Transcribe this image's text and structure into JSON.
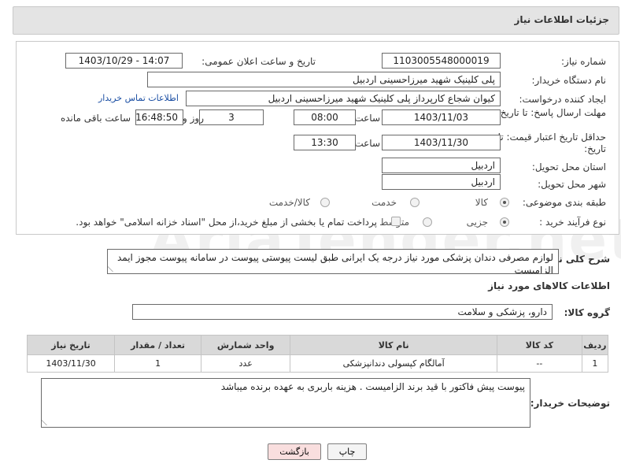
{
  "header": {
    "title": "جزئیات اطلاعات نیاز"
  },
  "form": {
    "need_number_label": "شماره نیاز:",
    "need_number": "1103005548000019",
    "announce_label": "تاریخ و ساعت اعلان عمومی:",
    "announce_value": "1403/10/29 - 14:07",
    "buyer_org_label": "نام دستگاه خریدار:",
    "buyer_org": "پلی کلینیک شهید میرزاحسینی اردبیل",
    "creator_label": "ایجاد کننده درخواست:",
    "creator": "کیوان شجاع کارپرداز پلی کلینیک شهید میرزاحسینی اردبیل",
    "contact_link": "اطلاعات تماس خریدار",
    "reply_deadline_label": "مهلت ارسال پاسخ: تا تاریخ:",
    "reply_date": "1403/11/03",
    "time_label": "ساعت",
    "reply_time": "08:00",
    "days": "3",
    "days_and": "روز و",
    "remaining_time": "16:48:50",
    "remaining_label": "ساعت باقی مانده",
    "validity_label": "حداقل تاریخ اعتبار قیمت: تا تاریخ:",
    "validity_date": "1403/11/30",
    "validity_time": "13:30",
    "province_label": "استان محل تحویل:",
    "province": "اردبیل",
    "city_label": "شهر محل تحویل:",
    "city": "اردبیل",
    "category_label": "طبقه بندی موضوعی:",
    "category_options": [
      "کالا",
      "خدمت",
      "کالا/خدمت"
    ],
    "process_label": "نوع فرآیند خرید :",
    "process_options": [
      "جزیی",
      "متوسط"
    ],
    "payment_note": "پرداخت تمام یا بخشی از مبلغ خرید،از محل \"اسناد خزانه اسلامی\" خواهد بود."
  },
  "description": {
    "label": "شرح کلی نیاز:",
    "text": "لوازم مصرفی دندان پزشکی مورد نیاز درجه یک ایرانی طبق لیست پیوستی پیوست  در سامانه پیوست مجوز ایمد الزامیست"
  },
  "goods": {
    "section_title": "اطلاعات کالاهای مورد نیاز",
    "group_label": "گروه کالا:",
    "group_value": "دارو، پزشکی و سلامت",
    "columns": [
      "ردیف",
      "کد کالا",
      "نام کالا",
      "واحد شمارش",
      "تعداد / مقدار",
      "تاریخ نیاز"
    ],
    "rows": [
      {
        "row": "1",
        "code": "--",
        "name": "آمالگام کپسولی دندانپزشکی",
        "unit": "عدد",
        "qty": "1",
        "date": "1403/11/30"
      }
    ]
  },
  "buyer_notes": {
    "label": "توضیحات خریدار:",
    "text": "پیوست پیش فاکتور با قید برند الزامیست . هزینه باربری به عهده برنده میباشد"
  },
  "buttons": {
    "print": "چاپ",
    "back": "بازگشت"
  },
  "watermark": "AriaTender.net",
  "colors": {
    "header_bg": "#e4e4e4",
    "link": "#1a4ea3",
    "back_button_bg": "#f9dede"
  }
}
